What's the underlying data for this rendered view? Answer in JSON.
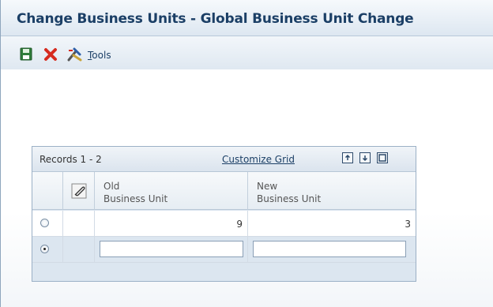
{
  "window": {
    "title": "Change Business Units - Global Business Unit Change"
  },
  "toolbar": {
    "save_icon": "save-icon",
    "cancel_icon": "close-icon",
    "tools_icon": "tools-icon",
    "tools_label_underlined": "T",
    "tools_label_rest": "ools"
  },
  "grid": {
    "records_label": "Records 1 - 2",
    "customize_label": "Customize Grid",
    "columns": [
      {
        "line1": "Old",
        "line2": "Business Unit"
      },
      {
        "line1": "New",
        "line2": "Business Unit"
      }
    ],
    "rows": [
      {
        "selected": false,
        "old_bu": "9",
        "new_bu": "3"
      },
      {
        "selected": true,
        "old_bu": "",
        "new_bu": ""
      }
    ]
  },
  "colors": {
    "title": "#1b3f66",
    "accent": "#2d4a6b",
    "cancel": "#d62b1f",
    "save": "#2f7d3a"
  }
}
